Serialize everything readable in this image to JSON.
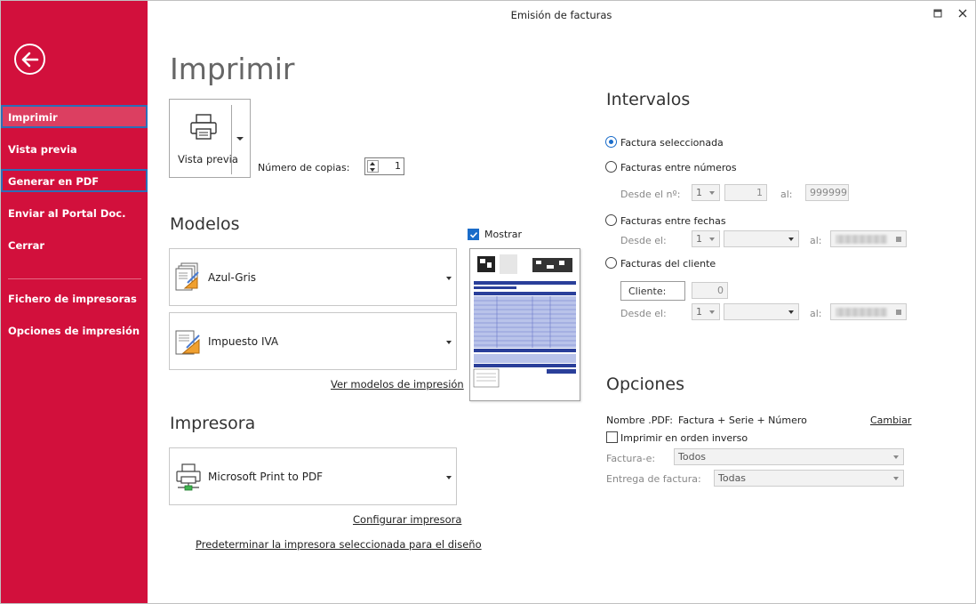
{
  "window": {
    "title": "Emisión de facturas",
    "maximize_icon": "maximize-icon",
    "close_icon": "close-icon"
  },
  "sidebar": {
    "items": [
      {
        "label": "Imprimir"
      },
      {
        "label": "Vista previa"
      },
      {
        "label": "Generar en PDF"
      },
      {
        "label": "Enviar al Portal Doc."
      },
      {
        "label": "Cerrar"
      },
      {
        "label": "Fichero de impresoras"
      },
      {
        "label": "Opciones de impresión"
      }
    ],
    "accent": "#d2103c"
  },
  "main": {
    "title": "Imprimir",
    "preview_button": "Vista previa",
    "copies_label": "Número de copias:",
    "copies_value": "1"
  },
  "models": {
    "title": "Modelos",
    "show_label": "Mostrar",
    "model1": "Azul-Gris",
    "model2": "Impuesto IVA",
    "link": "Ver modelos de impresión"
  },
  "printer": {
    "title": "Impresora",
    "name": "Microsoft Print to PDF",
    "configure_link": "Configurar impresora",
    "default_link": "Predeterminar la impresora seleccionada para el diseño"
  },
  "intervals": {
    "title": "Intervalos",
    "opt_selected": "Factura seleccionada",
    "opt_numbers": "Facturas entre números",
    "opt_dates": "Facturas entre fechas",
    "opt_client": "Facturas del cliente",
    "from_no_label": "Desde el nº:",
    "series_from": "1",
    "number_from": "1",
    "to_label": "al:",
    "number_to": "999999",
    "from_label": "Desde el:",
    "date_series": "1",
    "client_label": "Cliente:",
    "client_value": "0",
    "client_series": "1"
  },
  "options": {
    "title": "Opciones",
    "pdf_label": "Nombre .PDF:",
    "pdf_value": "Factura + Serie + Número",
    "change_link": "Cambiar",
    "reverse_label": "Imprimir en orden inverso",
    "einvoice_label": "Factura-e:",
    "einvoice_value": "Todos",
    "delivery_label": "Entrega de factura:",
    "delivery_value": "Todas"
  }
}
